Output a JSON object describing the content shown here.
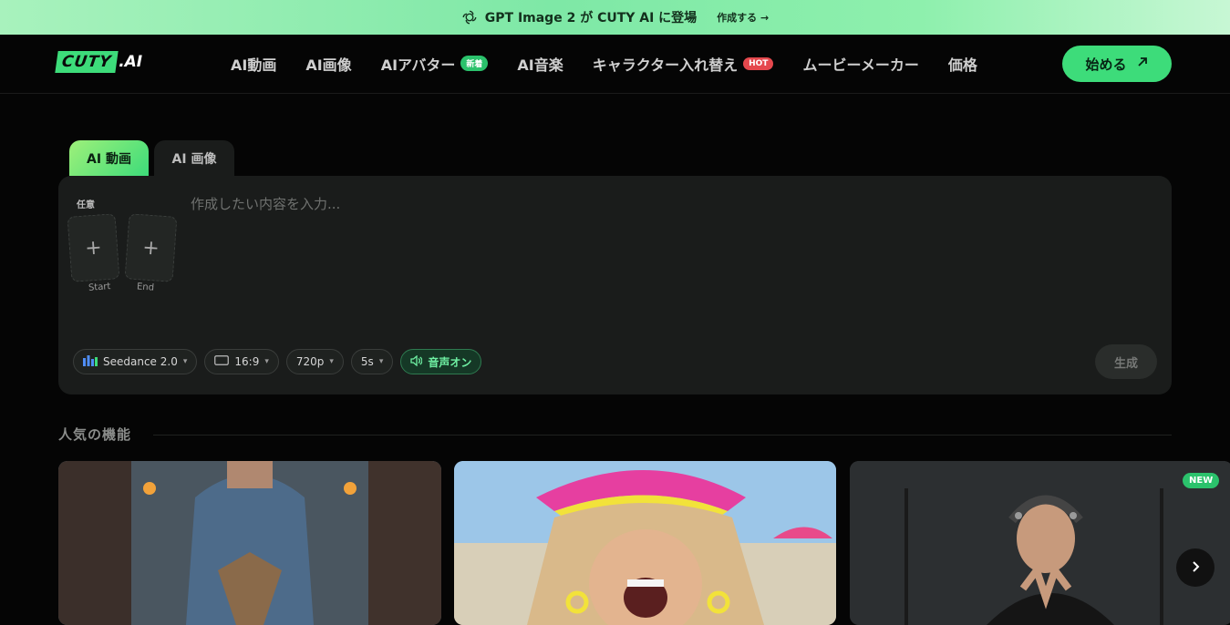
{
  "banner": {
    "icon": "openai-logo-icon",
    "text": "GPT Image 2 が CUTY AI に登場",
    "link_label": "作成する →"
  },
  "header": {
    "brand_box": "CUTY",
    "brand_suffix": ".AI",
    "nav": [
      {
        "label": "AI動画"
      },
      {
        "label": "AI画像"
      },
      {
        "label": "AIアバター",
        "badge": "新着"
      },
      {
        "label": "AI音楽"
      },
      {
        "label": "キャラクター入れ替え",
        "badge": "HOT"
      },
      {
        "label": "ムービーメーカー"
      },
      {
        "label": "価格"
      }
    ],
    "start_button": "始める",
    "start_icon": "arrow-up-right-icon"
  },
  "tabs": [
    {
      "label": "AI 動画",
      "active": true
    },
    {
      "label": "AI 画像",
      "active": false
    }
  ],
  "composer": {
    "optional_label": "任意",
    "frames": [
      {
        "label": "Start"
      },
      {
        "label": "End"
      }
    ],
    "prompt_placeholder": "作成したい内容を入力...",
    "prompt_value": "",
    "controls": {
      "model": "Seedance 2.0",
      "aspect_ratio": "16:9",
      "resolution": "720p",
      "duration": "5s",
      "audio": "音声オン"
    },
    "generate_label": "生成"
  },
  "popular": {
    "title": "人気の機能",
    "new_badge": "NEW"
  },
  "colors": {
    "accent": "#3ddc7a",
    "background": "#050505",
    "panel": "#1a1c1b",
    "hot": "#e5484d"
  }
}
